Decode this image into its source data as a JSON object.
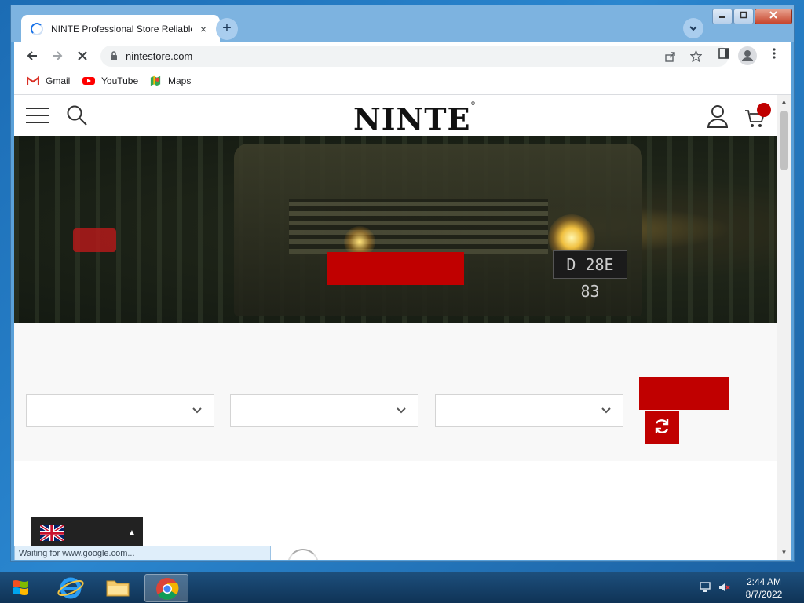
{
  "browser": {
    "tab_title": "NINTE Professional Store Reliable",
    "tab_close": "×",
    "new_tab": "+",
    "url": "nintestore.com",
    "bookmarks": [
      {
        "label": "Gmail",
        "icon": "gmail-icon"
      },
      {
        "label": "YouTube",
        "icon": "youtube-icon"
      },
      {
        "label": "Maps",
        "icon": "maps-icon"
      }
    ]
  },
  "site": {
    "logo": "NINTE",
    "logo_mark": "®",
    "hero": {
      "plate": "D 28E 83"
    }
  },
  "language": {
    "caret": "▲"
  },
  "status_text": "Waiting for www.google.com...",
  "taskbar": {
    "time": "2:44 AM",
    "date": "8/7/2022"
  },
  "colors": {
    "brand_red": "#c00000",
    "chrome_frame": "#7db3e0",
    "taskbar": "#1d4f7c"
  }
}
